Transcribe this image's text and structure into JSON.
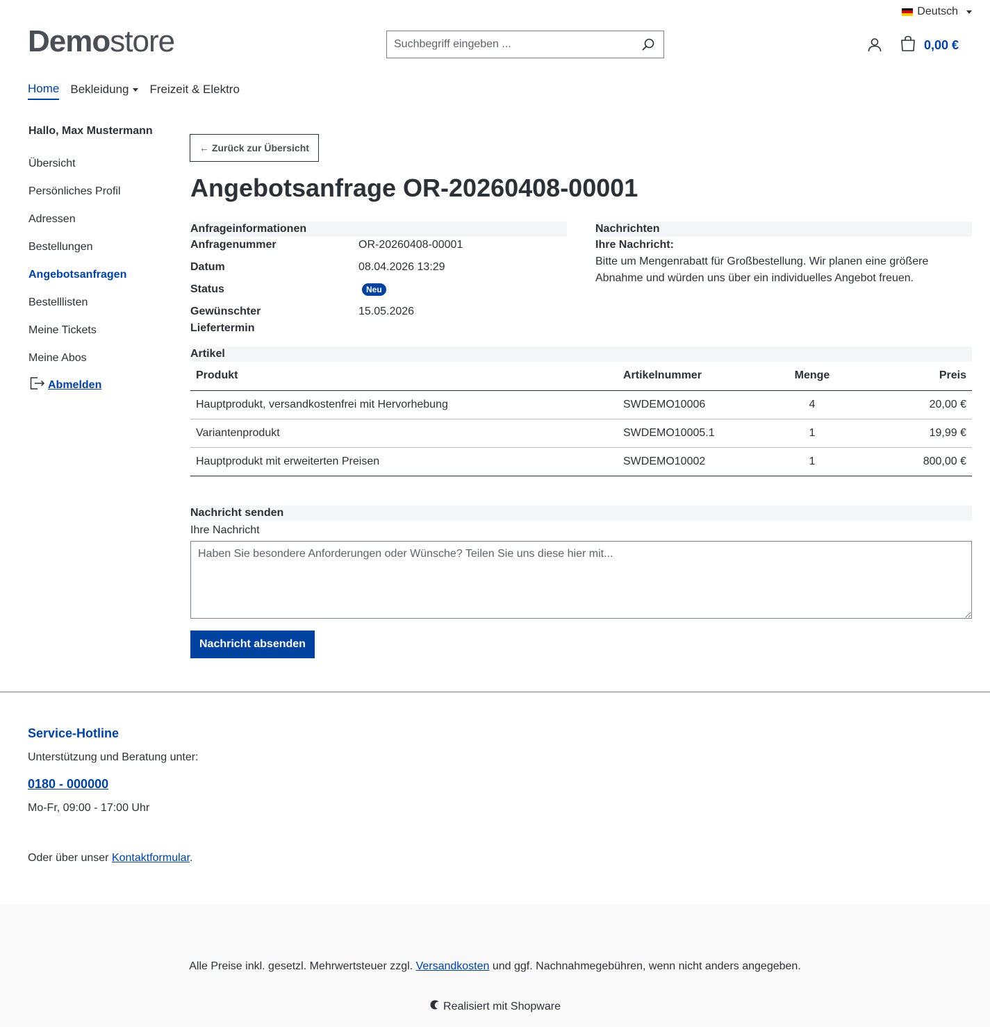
{
  "header": {
    "language": "Deutsch",
    "logo_bold": "Demo",
    "logo_light": "store",
    "search_placeholder": "Suchbegriff eingeben ...",
    "cart_total": "0,00 €"
  },
  "nav": {
    "items": [
      {
        "label": "Home"
      },
      {
        "label": "Bekleidung"
      },
      {
        "label": "Freizeit & Elektro"
      }
    ]
  },
  "sidebar": {
    "greeting": "Hallo, Max Mustermann",
    "links": [
      {
        "label": "Übersicht"
      },
      {
        "label": "Persönliches Profil"
      },
      {
        "label": "Adressen"
      },
      {
        "label": "Bestellungen"
      },
      {
        "label": "Angebotsanfragen"
      },
      {
        "label": "Bestelllisten"
      },
      {
        "label": "Meine Tickets"
      },
      {
        "label": "Meine Abos"
      }
    ],
    "logout": "Abmelden"
  },
  "content": {
    "back": "← Zurück zur Übersicht",
    "title": "Angebotsanfrage OR-20260408-00001",
    "info_head": "Anfrageinformationen",
    "info": {
      "number_label": "Anfragenummer",
      "number": "OR-20260408-00001",
      "date_label": "Datum",
      "date": "08.04.2026 13:29",
      "status_label": "Status",
      "status": "Neu",
      "delivery_label": "Gewünschter Liefertermin",
      "delivery": "15.05.2026"
    },
    "messages_head": "Nachrichten",
    "message_label": "Ihre Nachricht:",
    "message_text": "Bitte um Mengenrabatt für Großbestellung. Wir planen eine größere Abnahme und würden uns über ein individuelles Angebot freuen.",
    "articles_head": "Artikel",
    "table": {
      "headers": {
        "product": "Produkt",
        "number": "Artikelnummer",
        "qty": "Menge",
        "price": "Preis"
      },
      "rows": [
        {
          "product": "Hauptprodukt, versandkostenfrei mit Hervorhebung",
          "number": "SWDEMO10006",
          "qty": "4",
          "price": "20,00 €"
        },
        {
          "product": "Variantenprodukt",
          "number": "SWDEMO10005.1",
          "qty": "1",
          "price": "19,99 €"
        },
        {
          "product": "Hauptprodukt mit erweiterten Preisen",
          "number": "SWDEMO10002",
          "qty": "1",
          "price": "800,00 €"
        }
      ]
    },
    "send_head": "Nachricht senden",
    "send_label": "Ihre Nachricht",
    "send_placeholder": "Haben Sie besondere Anforderungen oder Wünsche? Teilen Sie uns diese hier mit...",
    "send_button": "Nachricht absenden"
  },
  "footer": {
    "hotline_title": "Service-Hotline",
    "hotline_sub": "Unterstützung und Beratung unter:",
    "phone": "0180 - 000000",
    "hours": "Mo-Fr, 09:00 - 17:00 Uhr",
    "contact_prefix": "Oder über unser ",
    "contact_link": "Kontaktformular",
    "contact_suffix": ".",
    "vat_prefix": "Alle Preise inkl. gesetzl. Mehrwertsteuer zzgl. ",
    "vat_link": "Versandkosten",
    "vat_suffix": " und ggf. Nachnahmegebühren, wenn nicht anders angegeben.",
    "powered": "Realisiert mit Shopware"
  },
  "colors": {
    "accent": "#0042a0",
    "text": "#2b3136",
    "section_bg": "#f5f6f7"
  }
}
